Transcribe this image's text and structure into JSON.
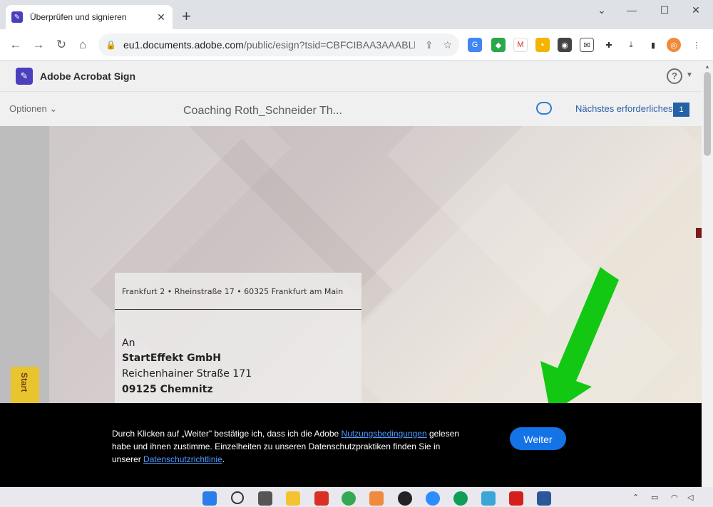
{
  "browser": {
    "tab_title": "Überprüfen und signieren",
    "tab_favicon": "acrobat-icon",
    "new_tab": "+",
    "url_host": "eu1.documents.adobe.com",
    "url_rest": "/public/esign?tsid=CBFCIBAA3AAABLb...",
    "window_controls": [
      "⌄",
      "—",
      "☐",
      "✕"
    ]
  },
  "app": {
    "name": "Adobe Acrobat Sign",
    "help": "?",
    "options_label": "Optionen",
    "document_title": "Coaching Roth_Schneider Th...",
    "next_required_label": "Nächstes erforderliches",
    "next_required_count": "1",
    "start_label": "Start"
  },
  "letter": {
    "sender_line": "Frankfurt 2 • Rheinstraße 17 • 60325 Frankfurt am Main",
    "address": [
      "An",
      "StartEffekt GmbH",
      "Reichenhainer Straße 171",
      "09125 Chemnitz"
    ]
  },
  "consent": {
    "text_before": "Durch Klicken auf „Weiter\" bestätige ich, dass ich die Adobe ",
    "terms_link": "Nutzungsbedingungen",
    "text_middle": " gelesen habe und ihnen zustimme. Einzelheiten zu unseren Datenschutzpraktiken finden Sie in unserer ",
    "privacy_link": "Datenschutzrichtlinie",
    "text_after": ".",
    "button_label": "Weiter"
  },
  "colors": {
    "accent_blue": "#1473e6",
    "acrobat_purple": "#4b3fbd",
    "arrow_green": "#12c812",
    "banner": "#000000"
  }
}
